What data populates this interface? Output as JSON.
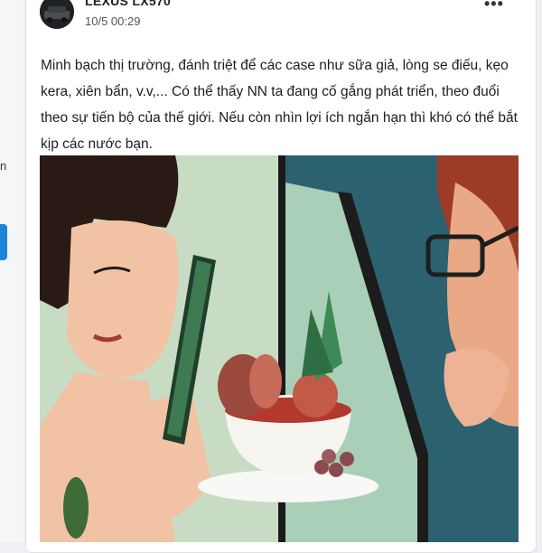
{
  "post": {
    "author": "LEXUS LX570",
    "timestamp": "10/5 00:29",
    "more_label": "•••",
    "text": "Minh bạch thị trường, đánh triệt để các case như sữa giả, lòng se điếu, kẹo kera, xiên bẩn, v.v,... Có thể thấy NN ta đang cố gắng phát triển, theo đuổi theo sự tiến bộ của thế giới. Nếu còn nhìn lợi ích ngắn hạn thì khó có thể bắt kịp các nước bạn."
  },
  "left_strip": {
    "text": "n"
  },
  "colors": {
    "accent": "#1a86d6",
    "card": "#ffffff",
    "page_bg": "#eef0f3"
  },
  "icons": [
    "more-options-icon",
    "avatar"
  ]
}
